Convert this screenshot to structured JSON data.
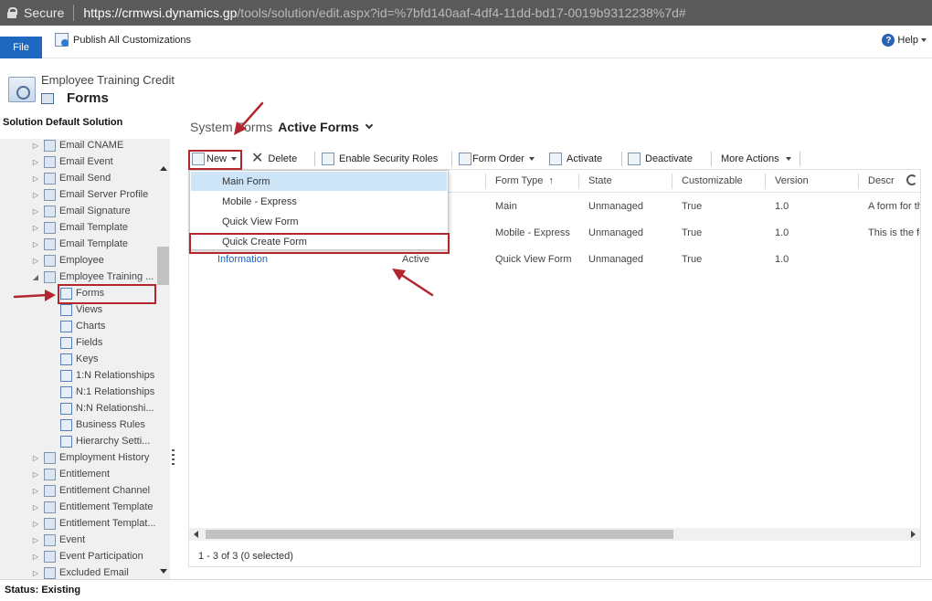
{
  "browser": {
    "secure_label": "Secure",
    "url_scheme": "https://",
    "url_host": "crmwsi.dynamics.gp",
    "url_path": "/tools/solution/edit.aspx?id=%7bfd140aaf-4df4-11dd-bd17-0019b9312238%7d#"
  },
  "commandbar": {
    "file_label": "File",
    "publish_label": "Publish All Customizations",
    "help_label": "Help"
  },
  "header": {
    "entity_name": "Employee Training Credit",
    "component": "Forms"
  },
  "sidebar": {
    "solution_label": "Solution Default Solution",
    "items": [
      {
        "label": "Email CNAME",
        "expander": "▷"
      },
      {
        "label": "Email Event",
        "expander": "▷"
      },
      {
        "label": "Email Send",
        "expander": "▷"
      },
      {
        "label": "Email Server Profile",
        "expander": "▷"
      },
      {
        "label": "Email Signature",
        "expander": "▷"
      },
      {
        "label": "Email Template",
        "expander": "▷"
      },
      {
        "label": "Email Template",
        "expander": "▷"
      },
      {
        "label": "Employee",
        "expander": "▷"
      },
      {
        "label": "Employee Training ...",
        "expander": "◢"
      },
      {
        "label": "Forms",
        "child": true
      },
      {
        "label": "Views",
        "child": true
      },
      {
        "label": "Charts",
        "child": true
      },
      {
        "label": "Fields",
        "child": true
      },
      {
        "label": "Keys",
        "child": true
      },
      {
        "label": "1:N Relationships",
        "child": true
      },
      {
        "label": "N:1 Relationships",
        "child": true
      },
      {
        "label": "N:N Relationshi...",
        "child": true
      },
      {
        "label": "Business Rules",
        "child": true
      },
      {
        "label": "Hierarchy Setti...",
        "child": true
      },
      {
        "label": "Employment History",
        "expander": "▷"
      },
      {
        "label": "Entitlement",
        "expander": "▷"
      },
      {
        "label": "Entitlement Channel",
        "expander": "▷"
      },
      {
        "label": "Entitlement Template",
        "expander": "▷"
      },
      {
        "label": "Entitlement Templat...",
        "expander": "▷"
      },
      {
        "label": "Event",
        "expander": "▷"
      },
      {
        "label": "Event Participation",
        "expander": "▷"
      },
      {
        "label": "Excluded Email",
        "expander": "▷"
      }
    ]
  },
  "view": {
    "system_label": "System Forms",
    "active_label": "Active Forms"
  },
  "toolbar": {
    "new_label": "New",
    "delete_label": "Delete",
    "security_label": "Enable Security Roles",
    "formorder_label": "Form Order",
    "activate_label": "Activate",
    "deactivate_label": "Deactivate",
    "more_label": "More Actions"
  },
  "grid": {
    "columns": [
      "Form Type",
      "State",
      "Customizable",
      "Version",
      "Descr"
    ],
    "sort_indicator": "↑",
    "rows": [
      {
        "name": "",
        "status": "",
        "type": "Main",
        "state": "Unmanaged",
        "customizable": "True",
        "version": "1.0",
        "description": "A form for th"
      },
      {
        "name": "",
        "status": "",
        "type": "Mobile - Express",
        "state": "Unmanaged",
        "customizable": "True",
        "version": "1.0",
        "description": "This is the fo"
      },
      {
        "name": "Information",
        "status": "Active",
        "type": "Quick View Form",
        "state": "Unmanaged",
        "customizable": "True",
        "version": "1.0",
        "description": ""
      }
    ],
    "record_count": "1 - 3 of 3 (0 selected)"
  },
  "new_menu": {
    "items": [
      "Main Form",
      "Mobile - Express",
      "Quick View Form",
      "Quick Create Form"
    ],
    "selected_index": 0
  },
  "status": {
    "text": "Status: Existing"
  },
  "colors": {
    "file_button": "#1f68bf",
    "link": "#1a62c4",
    "annotation_red": "#b3262e",
    "menu_highlight": "#cde5f7"
  }
}
